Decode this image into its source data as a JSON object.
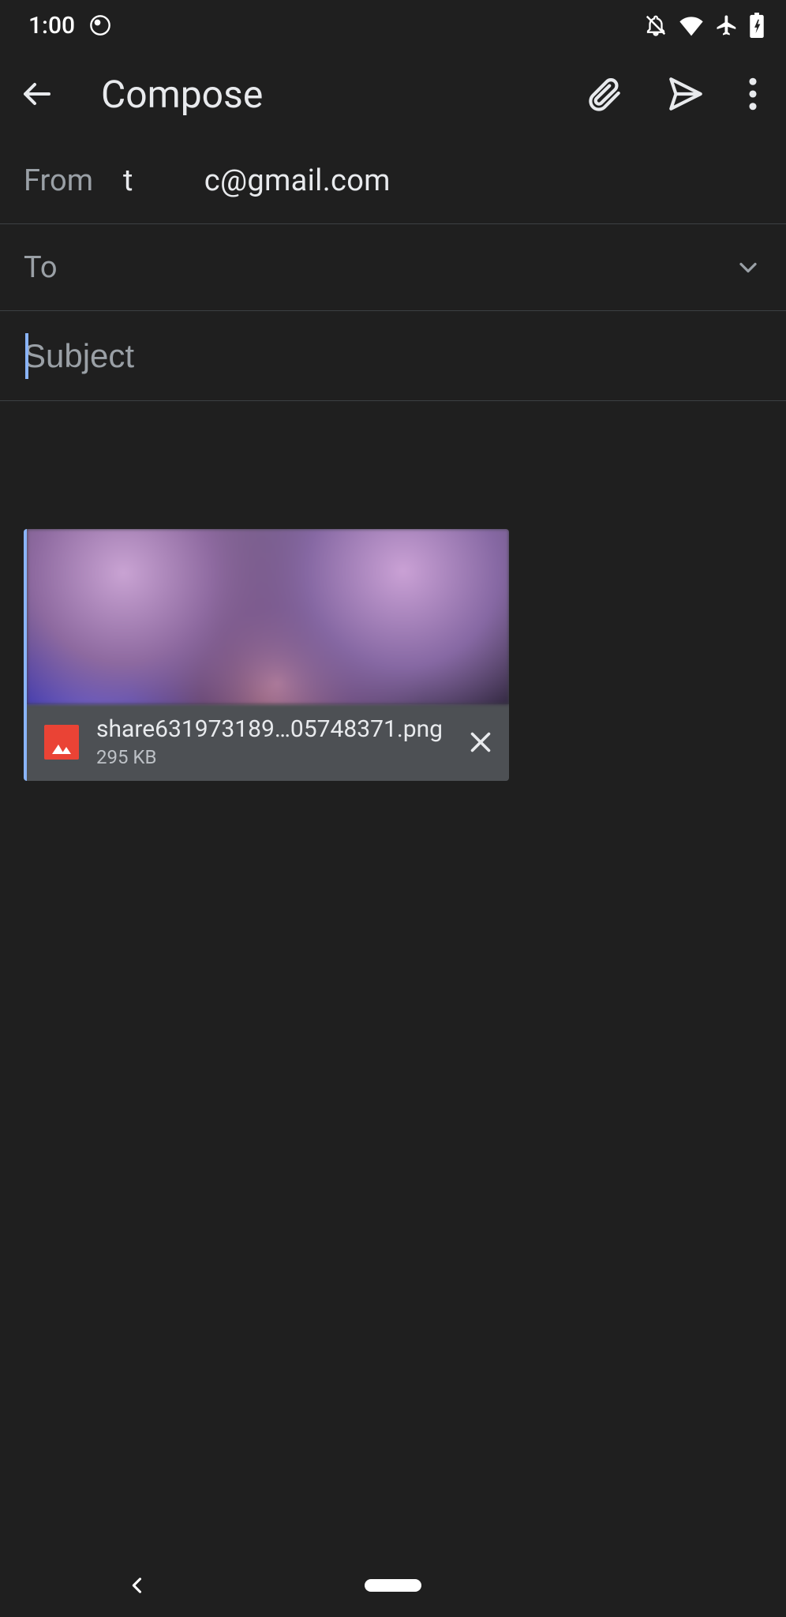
{
  "status": {
    "time": "1:00"
  },
  "header": {
    "title": "Compose"
  },
  "from": {
    "label": "From",
    "value_prefix": "t",
    "value_suffix": "c@gmail.com"
  },
  "to": {
    "label": "To"
  },
  "subject": {
    "placeholder": "Subject",
    "value": ""
  },
  "attachment": {
    "filename": "share631973189…05748371.png",
    "size": "295 KB"
  }
}
